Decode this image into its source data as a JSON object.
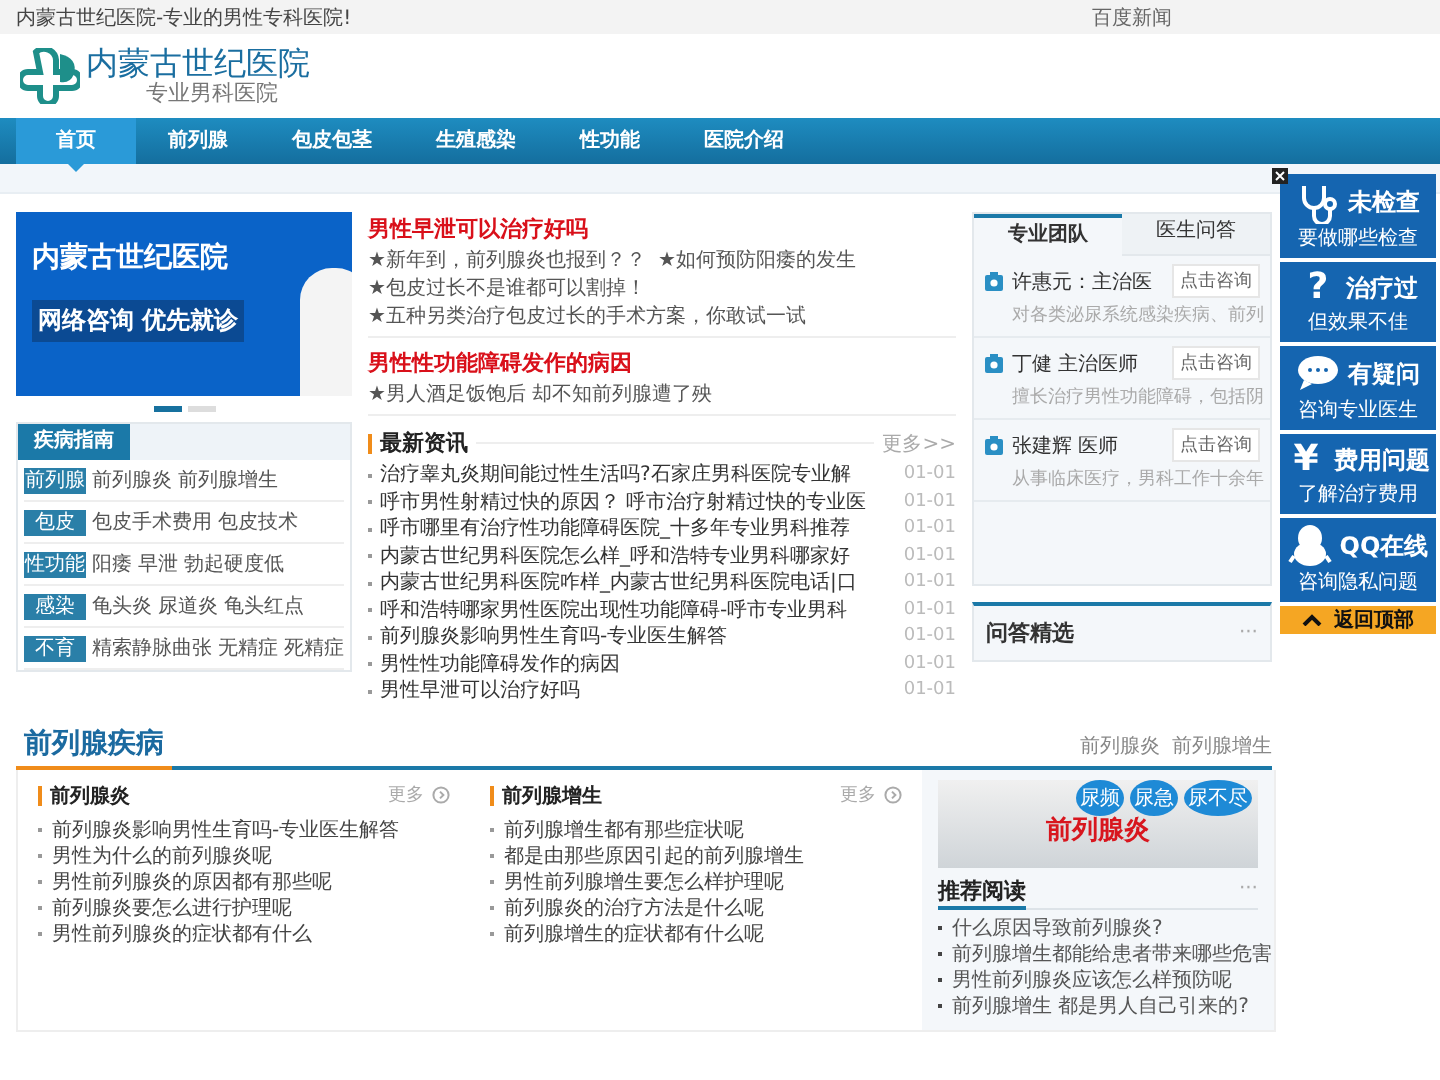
{
  "top_bar": {
    "tagline": "内蒙古世纪医院-专业的男性专科医院!",
    "link": "百度新闻"
  },
  "logo": {
    "name": "内蒙古世纪医院",
    "subtitle": "专业男科医院"
  },
  "nav": [
    {
      "label": "首页",
      "selected": true
    },
    {
      "label": "前列腺",
      "selected": false
    },
    {
      "label": "包皮包茎",
      "selected": false
    },
    {
      "label": "生殖感染",
      "selected": false
    },
    {
      "label": "性功能",
      "selected": false
    },
    {
      "label": "医院介绍",
      "selected": false
    }
  ],
  "banner": {
    "title": "内蒙古世纪医院",
    "slogan": "网络咨询 优先就诊",
    "dots": [
      {
        "selected": true
      },
      {
        "selected": false
      }
    ]
  },
  "disease_guide": {
    "title": "疾病指南",
    "rows": [
      {
        "tag": "前列腺",
        "links": [
          "前列腺炎",
          "前列腺增生"
        ]
      },
      {
        "tag": "包皮",
        "links": [
          "包皮手术费用",
          "包皮技术"
        ]
      },
      {
        "tag": "性功能",
        "links": [
          "阳痿",
          "早泄",
          "勃起硬度低"
        ]
      },
      {
        "tag": "感染",
        "links": [
          "龟头炎",
          "尿道炎",
          "龟头红点"
        ]
      },
      {
        "tag": "不育",
        "links": [
          "精索静脉曲张",
          "无精症",
          "死精症"
        ]
      }
    ]
  },
  "headlines": [
    {
      "title": "男性早泄可以治疗好吗",
      "links": [
        "★新年到，前列腺炎也报到？？",
        "★如何预防阳痿的发生",
        "★包皮过长不是谁都可以割掉！",
        "★五种另类治疗包皮过长的手术方案，你敢试一试"
      ]
    },
    {
      "title": "男性性功能障碍发作的病因",
      "links": [
        "★男人酒足饭饱后 却不知前列腺遭了殃"
      ]
    }
  ],
  "news": {
    "title": "最新资讯",
    "more": "更多>>",
    "items": [
      {
        "title": "治疗睾丸炎期间能过性生活吗?石家庄男科医院专业解",
        "date": "01-01"
      },
      {
        "title": "呼市男性射精过快的原因？ 呼市治疗射精过快的专业医",
        "date": "01-01"
      },
      {
        "title": "呼市哪里有治疗性功能障碍医院_十多年专业男科推荐",
        "date": "01-01"
      },
      {
        "title": "内蒙古世纪男科医院怎么样_呼和浩特专业男科哪家好",
        "date": "01-01"
      },
      {
        "title": "内蒙古世纪男科医院咋样_内蒙古世纪男科医院电话|口",
        "date": "01-01"
      },
      {
        "title": "呼和浩特哪家男性医院出现性功能障碍-呼市专业男科",
        "date": "01-01"
      },
      {
        "title": "前列腺炎影响男性生育吗-专业医生解答",
        "date": "01-01"
      },
      {
        "title": "男性性功能障碍发作的病因",
        "date": "01-01"
      },
      {
        "title": "男性早泄可以治疗好吗",
        "date": "01-01"
      }
    ]
  },
  "team": {
    "tabs": [
      {
        "label": "专业团队",
        "selected": true
      },
      {
        "label": "医生问答",
        "selected": false
      }
    ],
    "doctors": [
      {
        "name": "许惠元：主治医",
        "button": "点击咨询",
        "bio": "对各类泌尿系统感染疾病、前列"
      },
      {
        "name": "丁健 主治医师",
        "button": "点击咨询",
        "bio": "擅长治疗男性功能障碍，包括阴"
      },
      {
        "name": "张建辉 医师",
        "button": "点击咨询",
        "bio": "从事临床医疗，男科工作十余年"
      }
    ]
  },
  "qa": {
    "title": "问答精选",
    "more": "···"
  },
  "side_widget": {
    "items": [
      {
        "kind": "stethoscope",
        "title": "未检查",
        "subtitle": "要做哪些检查"
      },
      {
        "kind": "glyph",
        "glyph": "?",
        "title": "治疗过",
        "subtitle": "但效果不佳"
      },
      {
        "kind": "chat",
        "title": "有疑问",
        "subtitle": "咨询专业医生"
      },
      {
        "kind": "glyph",
        "glyph": "¥",
        "title": "费用问题",
        "subtitle": "了解治疗费用"
      },
      {
        "kind": "qq",
        "title": "QQ在线",
        "subtitle": "咨询隐私问题"
      }
    ],
    "back_to_top": "返回顶部"
  },
  "section": {
    "title": "前列腺疾病",
    "links": [
      "前列腺炎",
      "前列腺增生"
    ],
    "columns": [
      {
        "title": "前列腺炎",
        "more": "更多",
        "items": [
          "前列腺炎影响男性生育吗-专业医生解答",
          "男性为什么的前列腺炎呢",
          "男性前列腺炎的原因都有那些呢",
          "前列腺炎要怎么进行护理呢",
          "男性前列腺炎的症状都有什么"
        ]
      },
      {
        "title": "前列腺增生",
        "more": "更多",
        "items": [
          "前列腺增生都有那些症状呢",
          "都是由那些原因引起的前列腺增生",
          "男性前列腺增生要怎么样护理呢",
          "前列腺炎的治疗方法是什么呢",
          "前列腺增生的症状都有什么呢"
        ]
      }
    ],
    "image": {
      "balloons": [
        "尿频",
        "尿急",
        "尿不尽"
      ],
      "caption": "前列腺炎"
    },
    "recommended": {
      "title": "推荐阅读",
      "more": "···",
      "items": [
        "什么原因导致前列腺炎?",
        "前列腺增生都能给患者带来哪些危害",
        "男性前列腺炎应该怎么样预防呢",
        "前列腺增生 都是男人自己引来的?"
      ]
    }
  }
}
